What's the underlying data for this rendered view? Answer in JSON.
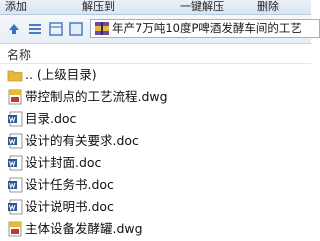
{
  "toolbar": {
    "add_label": "添加",
    "extract_label": "解压到",
    "oneclick_label": "一键解压",
    "delete_label": "删除"
  },
  "address_bar": {
    "path": "年产7万吨10度P啤酒发酵车间的工艺"
  },
  "columns": {
    "name": "名称"
  },
  "files": [
    {
      "name": ".. (上级目录)",
      "icon": "folder-icon"
    },
    {
      "name": "带控制点的工艺流程.dwg",
      "icon": "dwg-file-icon"
    },
    {
      "name": "目录.doc",
      "icon": "word-doc-icon"
    },
    {
      "name": "设计的有关要求.doc",
      "icon": "word-doc-icon"
    },
    {
      "name": "设计封面.doc",
      "icon": "word-doc-icon"
    },
    {
      "name": "设计任务书.doc",
      "icon": "word-doc-icon"
    },
    {
      "name": "设计说明书.doc",
      "icon": "word-doc-icon"
    },
    {
      "name": "主体设备发酵罐.dwg",
      "icon": "dwg-file-icon"
    }
  ],
  "colors": {
    "folder": "#e8b83a",
    "word_blue": "#2b579a",
    "dwg_red": "#c0392b"
  }
}
